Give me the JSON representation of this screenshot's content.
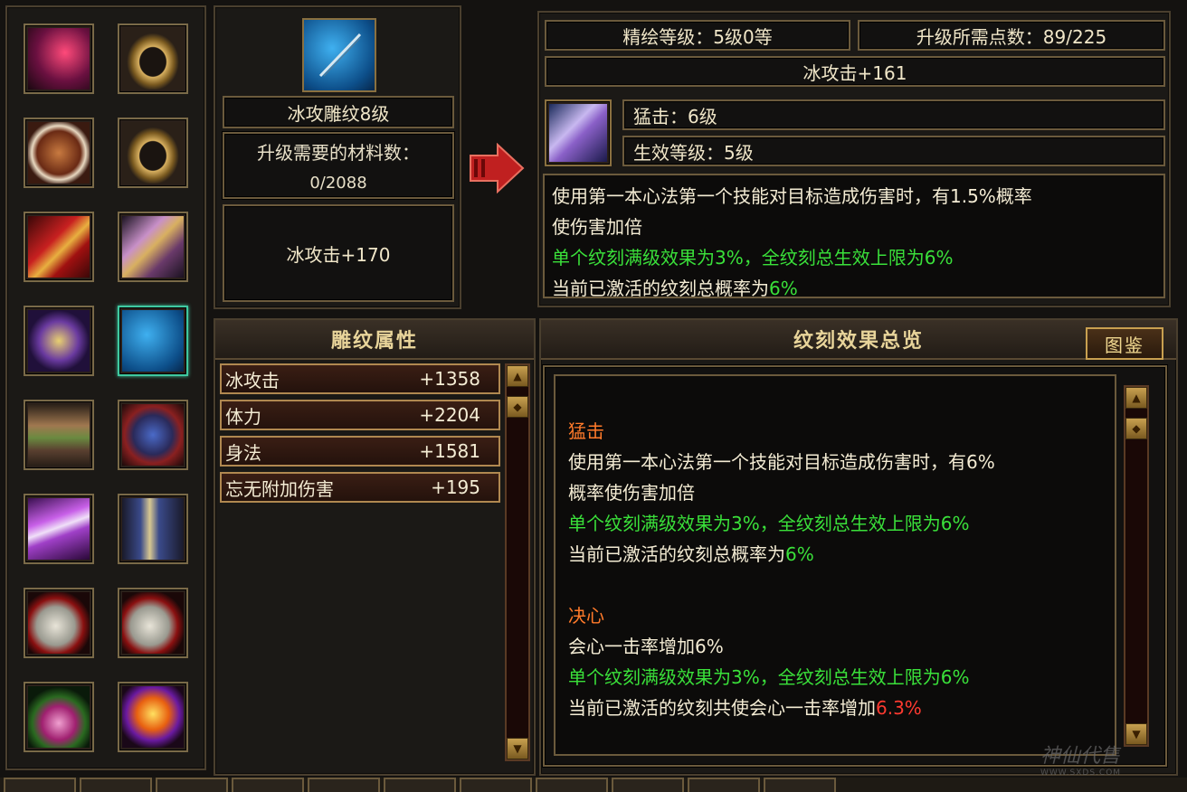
{
  "engrave": {
    "name": "冰攻雕纹8级",
    "material_label": "升级需要的材料数：",
    "material_value": "0/2088",
    "current_bonus": "冰攻击+170"
  },
  "upgrade": {
    "engrave_level": "精绘等级：5级0等",
    "points_needed": "升级所需点数：89/225",
    "next_bonus": "冰攻击+161",
    "skill_name": "猛击：6级",
    "effect_level": "生效等级：5级",
    "desc_line1": "使用第一本心法第一个技能对目标造成伤害时，有1.5%概率",
    "desc_line2": "使伤害加倍",
    "desc_line3": "单个纹刻满级效果为3%，全纹刻总生效上限为6%",
    "desc_line4_prefix": "当前已激活的纹刻总概率为",
    "desc_line4_value": "6%"
  },
  "attributes": {
    "title": "雕纹属性",
    "rows": [
      {
        "name": "冰攻击",
        "value": "+1358"
      },
      {
        "name": "体力",
        "value": "+2204"
      },
      {
        "name": "身法",
        "value": "+1581"
      },
      {
        "name": "忘无附加伤害",
        "value": "+195"
      }
    ]
  },
  "overview": {
    "title": "纹刻效果总览",
    "codex_button": "图鉴",
    "sections": [
      {
        "name": "猛击",
        "line1": "使用第一本心法第一个技能对目标造成伤害时，有6%",
        "line2": "概率使伤害加倍",
        "line3": "单个纹刻满级效果为3%，全纹刻总生效上限为6%",
        "line4_prefix": "当前已激活的纹刻总概率为",
        "line4_value": "6%"
      },
      {
        "name": "决心",
        "line1": "会心一击率增加6%",
        "line3": "单个纹刻满级效果为3%，全纹刻总生效上限为6%",
        "line4_prefix": "当前已激活的纹刻共使会心一击率增加",
        "line4_value": "6.3%"
      }
    ]
  },
  "watermark": {
    "text": "神仙代售",
    "url": "WWW.SXDS.COM"
  },
  "icons": {
    "equip_slots": [
      "wing-icon",
      "ring-icon",
      "mask-icon",
      "ring-icon",
      "scroll-icon",
      "bracer-icon",
      "amulet-icon",
      "needle-icon",
      "belt-icon",
      "glove-icon",
      "blade-icon",
      "boots-icon",
      "jade-pendant-icon",
      "jade-pendant-icon",
      "gem-necklace-icon",
      "talisman-icon"
    ],
    "engrave_item": "needle-icon",
    "skill": "skill-rune-icon"
  },
  "colors": {
    "green_text": "#3ae03a",
    "red_value": "#ff3a30",
    "orange_title": "#ff7a2a",
    "gold_border": "#b08850"
  }
}
